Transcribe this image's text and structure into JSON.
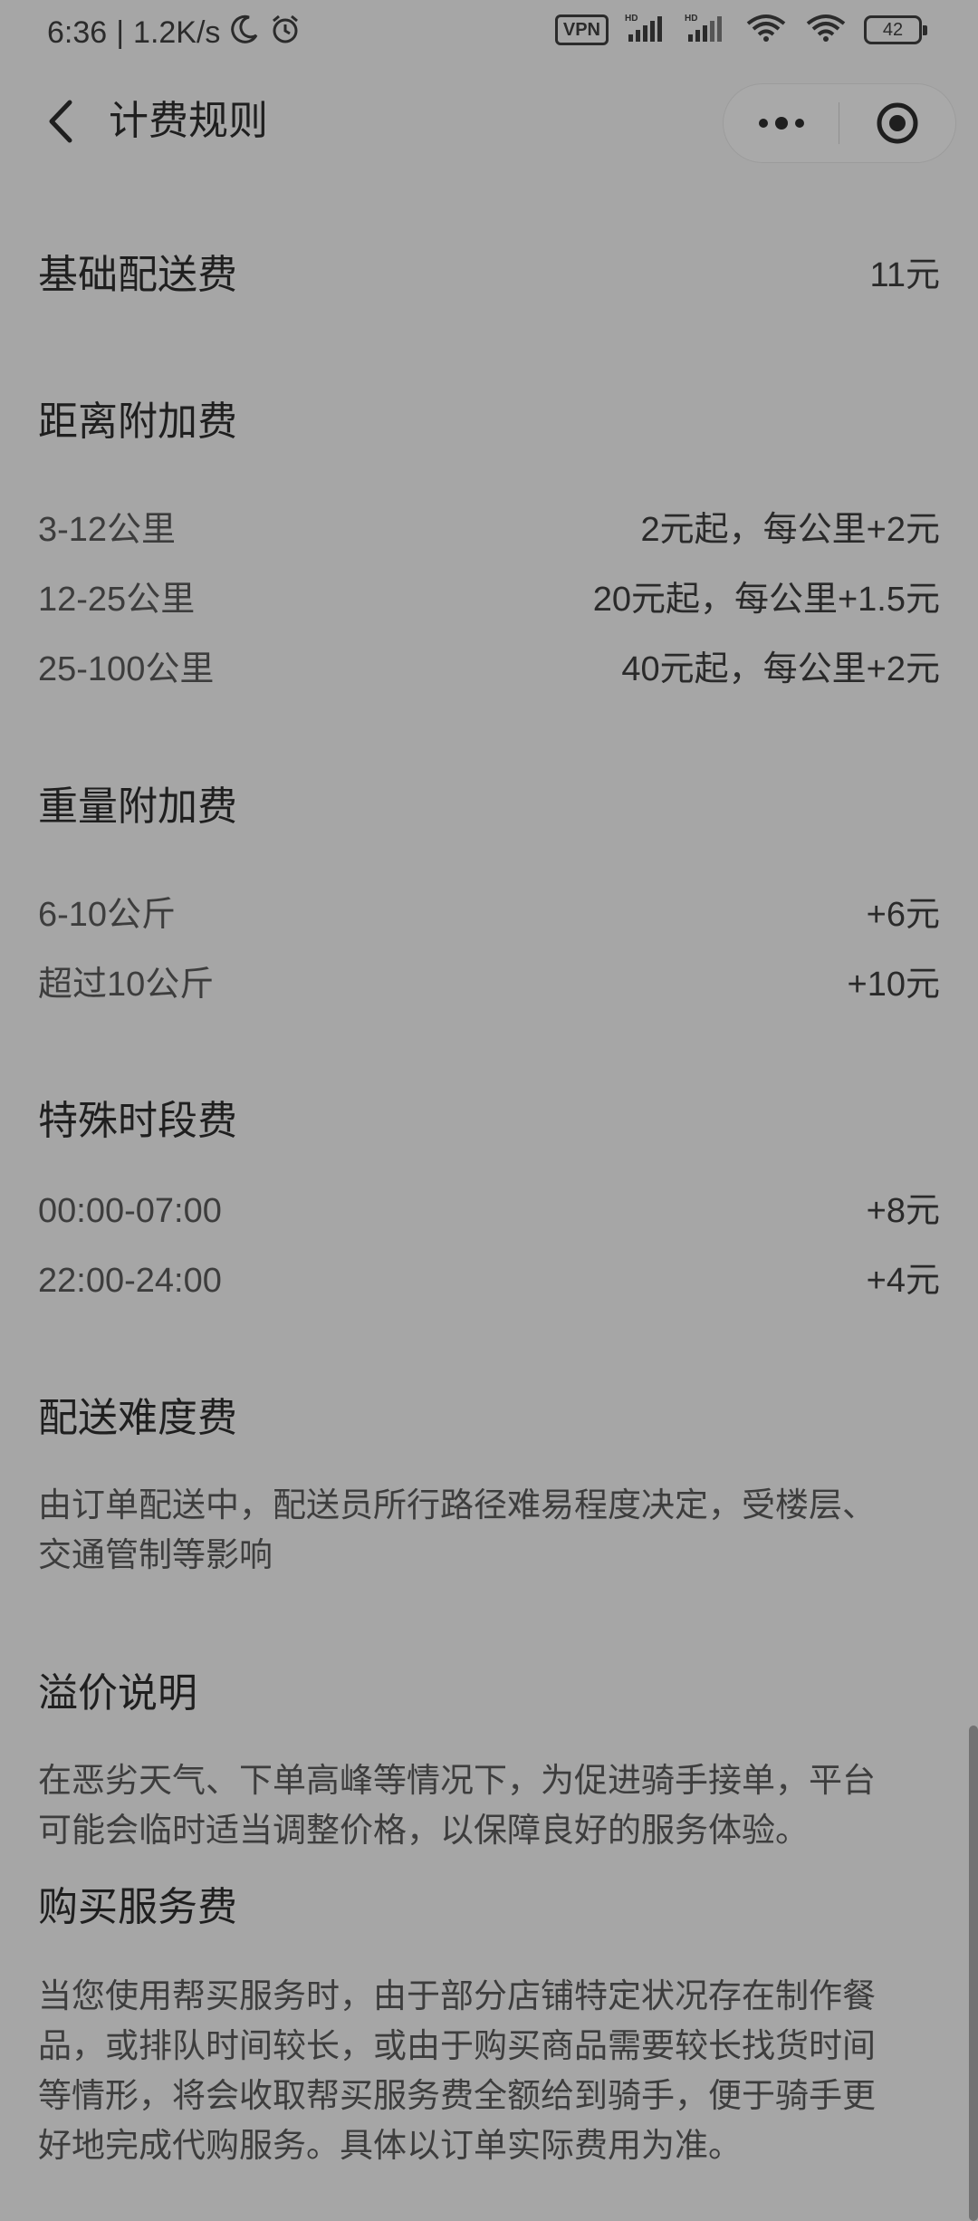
{
  "status": {
    "time": "6:36",
    "speed": "1.2K/s",
    "vpn": "VPN",
    "battery": "42"
  },
  "nav": {
    "title": "计费规则"
  },
  "sections": {
    "base": {
      "title": "基础配送费",
      "value": "11元"
    },
    "distance": {
      "title": "距离附加费",
      "rows": [
        {
          "label": "3-12公里",
          "value": "2元起，每公里+2元"
        },
        {
          "label": "12-25公里",
          "value": "20元起，每公里+1.5元"
        },
        {
          "label": "25-100公里",
          "value": "40元起，每公里+2元"
        }
      ]
    },
    "weight": {
      "title": "重量附加费",
      "rows": [
        {
          "label": "6-10公斤",
          "value": "+6元"
        },
        {
          "label": "超过10公斤",
          "value": "+10元"
        }
      ]
    },
    "special_time": {
      "title": "特殊时段费",
      "rows": [
        {
          "label": "00:00-07:00",
          "value": "+8元"
        },
        {
          "label": "22:00-24:00",
          "value": "+4元"
        }
      ]
    },
    "difficulty": {
      "title": "配送难度费",
      "lines": [
        "由订单配送中，配送员所行路径难易程度决定，受楼层、",
        "交通管制等影响"
      ]
    },
    "premium": {
      "title": "溢价说明",
      "lines": [
        "在恶劣天气、下单高峰等情况下，为促进骑手接单，平台",
        "可能会临时适当调整价格，以保障良好的服务体验。"
      ]
    },
    "purchase": {
      "title": "购买服务费",
      "lines": [
        "当您使用帮买服务时，由于部分店铺特定状况存在制作餐",
        "品，或排队时间较长，或由于购买商品需要较长找货时间",
        "等情形，将会收取帮买服务费全额给到骑手，便于骑手更",
        "好地完成代购服务。具体以订单实际费用为准。"
      ]
    }
  }
}
